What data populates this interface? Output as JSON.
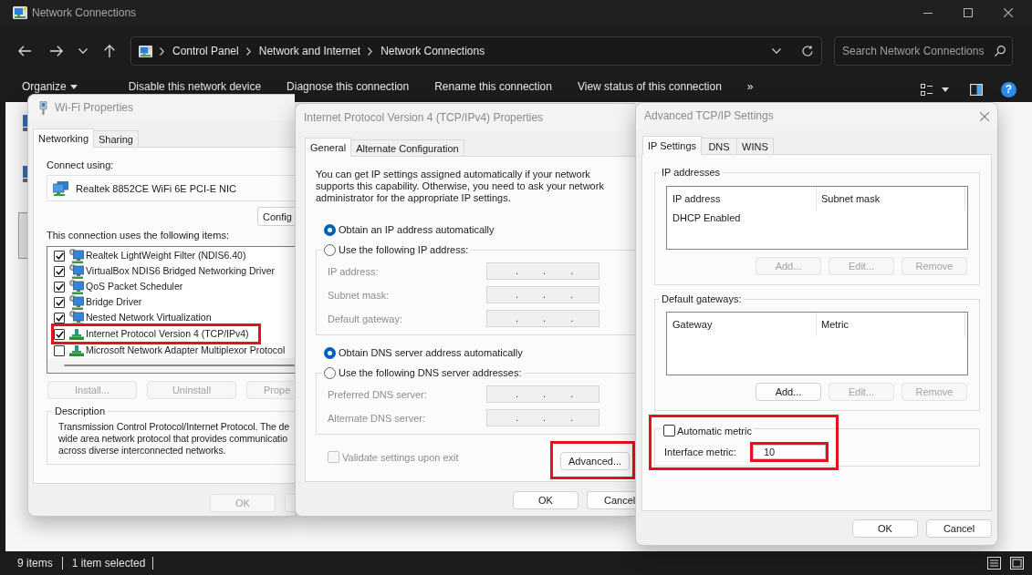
{
  "explorer": {
    "title": "Network Connections",
    "breadcrumb": [
      "Control Panel",
      "Network and Internet",
      "Network Connections"
    ],
    "search": {
      "placeholder": "Search Network Connections"
    },
    "commands": [
      {
        "label": "Organize",
        "kind": "menu"
      },
      {
        "label": "Disable this network device",
        "kind": "action"
      },
      {
        "label": "Diagnose this connection",
        "kind": "action"
      },
      {
        "label": "Rename this connection",
        "kind": "action"
      },
      {
        "label": "View status of this connection",
        "kind": "action"
      },
      {
        "label": "»",
        "kind": "overflow"
      }
    ],
    "help_button": {
      "label": "?"
    },
    "status_bar": {
      "item_count": "9 items",
      "selection": "1 item selected"
    }
  },
  "wifi_properties": {
    "title": "Wi-Fi Properties",
    "tabs": [
      {
        "label": "Networking",
        "selected": true
      },
      {
        "label": "Sharing",
        "selected": false
      }
    ],
    "connect_using": {
      "label": "Connect using:",
      "adapter": "Realtek 8852CE WiFi 6E PCI-E NIC"
    },
    "configure_button": {
      "label": "Config"
    },
    "items_label": "This connection uses the following items:",
    "items": [
      {
        "label": "Realtek LightWeight Filter (NDIS6.40)",
        "kind": "service",
        "checked": true,
        "highlighted": false
      },
      {
        "label": "VirtualBox NDIS6 Bridged Networking Driver",
        "kind": "service",
        "checked": true,
        "highlighted": false
      },
      {
        "label": "QoS Packet Scheduler",
        "kind": "service",
        "checked": true,
        "highlighted": false
      },
      {
        "label": "Bridge Driver",
        "kind": "service",
        "checked": true,
        "highlighted": false
      },
      {
        "label": "Nested Network Virtualization",
        "kind": "service",
        "checked": true,
        "highlighted": false
      },
      {
        "label": "Internet Protocol Version 4 (TCP/IPv4)",
        "kind": "protocol",
        "checked": true,
        "highlighted": true
      },
      {
        "label": "Microsoft Network Adapter Multiplexor Protocol",
        "kind": "protocol",
        "checked": false,
        "highlighted": false
      }
    ],
    "item_buttons": [
      {
        "label": "Install...",
        "disabled": true
      },
      {
        "label": "Uninstall",
        "disabled": true
      },
      {
        "label": "Prope",
        "disabled": true
      }
    ],
    "description": {
      "legend": "Description",
      "lines": [
        "Transmission Control Protocol/Internet Protocol. The de",
        "wide area network protocol that provides communicatio",
        "across diverse interconnected networks."
      ]
    },
    "buttons": [
      {
        "label": "OK",
        "disabled": true
      }
    ]
  },
  "ipv4_properties": {
    "title": "Internet Protocol Version 4 (TCP/IPv4) Properties",
    "tabs": [
      {
        "label": "General",
        "selected": true
      },
      {
        "label": "Alternate Configuration",
        "selected": false
      }
    ],
    "intro": "You can get IP settings assigned automatically if your network supports this capability. Otherwise, you need to ask your network administrator for the appropriate IP settings.",
    "sections": [
      {
        "auto_option": {
          "label": "Obtain an IP address automatically",
          "selected": true
        },
        "manual_option": {
          "label": "Use the following IP address:",
          "selected": false
        },
        "fields": [
          {
            "label": "IP address:",
            "value": ". . .",
            "disabled": true
          },
          {
            "label": "Subnet mask:",
            "value": ". . .",
            "disabled": true
          },
          {
            "label": "Default gateway:",
            "value": ". . .",
            "disabled": true
          }
        ]
      },
      {
        "auto_option": {
          "label": "Obtain DNS server address automatically",
          "selected": true
        },
        "manual_option": {
          "label": "Use the following DNS server addresses:",
          "selected": false
        },
        "fields": [
          {
            "label": "Preferred DNS server:",
            "value": ". . .",
            "disabled": true
          },
          {
            "label": "Alternate DNS server:",
            "value": ". . .",
            "disabled": true
          }
        ]
      }
    ],
    "validate": {
      "label": "Validate settings upon exit",
      "checked": false,
      "disabled": true
    },
    "advanced_button": {
      "label": "Advanced...",
      "highlighted": true
    },
    "buttons": [
      {
        "label": "OK"
      },
      {
        "label": "Cancel"
      }
    ]
  },
  "advanced_tcpip": {
    "title": "Advanced TCP/IP Settings",
    "tabs": [
      {
        "label": "IP Settings",
        "selected": true
      },
      {
        "label": "DNS",
        "selected": false
      },
      {
        "label": "WINS",
        "selected": false
      }
    ],
    "groups": [
      {
        "legend": "IP addresses",
        "columns": [
          "IP address",
          "Subnet mask"
        ],
        "rows": [
          [
            "DHCP Enabled"
          ]
        ],
        "buttons": [
          {
            "label": "Add...",
            "disabled": true
          },
          {
            "label": "Edit...",
            "disabled": true
          },
          {
            "label": "Remove",
            "disabled": true
          }
        ]
      },
      {
        "legend": "Default gateways:",
        "columns": [
          "Gateway",
          "Metric"
        ],
        "buttons": [
          {
            "label": "Add...",
            "disabled": false
          },
          {
            "label": "Edit...",
            "disabled": true
          },
          {
            "label": "Remove",
            "disabled": true
          }
        ]
      }
    ],
    "metric": {
      "highlighted": true,
      "automatic": {
        "label": "Automatic metric",
        "checked": false
      },
      "interface": {
        "label": "Interface metric:",
        "value": "10",
        "highlighted": true
      }
    },
    "buttons": [
      {
        "label": "OK"
      },
      {
        "label": "Cancel"
      }
    ]
  }
}
